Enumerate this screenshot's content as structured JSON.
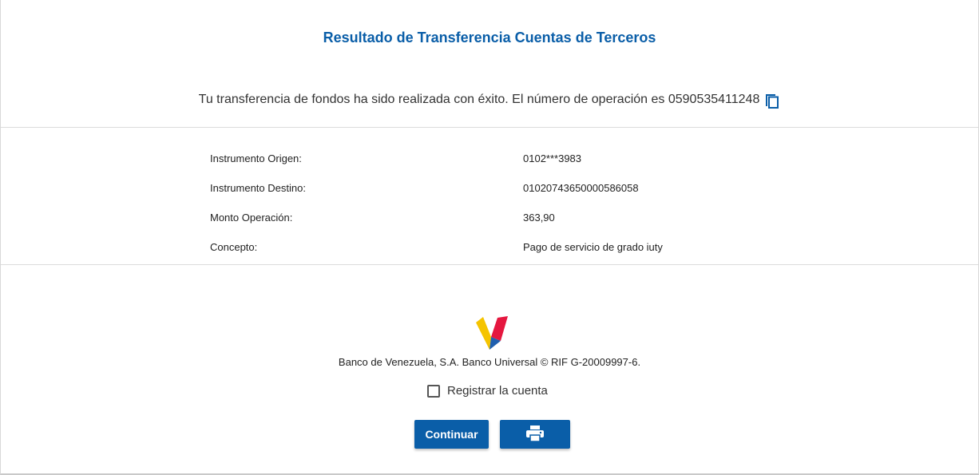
{
  "header": {
    "title": "Resultado de Transferencia Cuentas de Terceros"
  },
  "message": {
    "text": "Tu transferencia de fondos ha sido realizada con éxito. El número de operación es 0590535411248",
    "copy_icon": "copy-icon"
  },
  "details": [
    {
      "label": "Instrumento Origen:",
      "value": "0102***3983"
    },
    {
      "label": "Instrumento Destino:",
      "value": "01020743650000586058"
    },
    {
      "label": "Monto Operación:",
      "value": "363,90"
    },
    {
      "label": "Concepto:",
      "value": "Pago de servicio de grado iuty"
    }
  ],
  "footer": {
    "bank_text": "Banco de Venezuela, S.A. Banco Universal © RIF G-20009997-6.",
    "register_label": "Registrar la cuenta",
    "register_checked": false
  },
  "buttons": {
    "continue_label": "Continuar",
    "print_icon": "printer-icon"
  },
  "colors": {
    "accent": "#0a5ea8",
    "logo_yellow": "#f5c400",
    "logo_red": "#e5173f",
    "logo_blue": "#1f5fae"
  }
}
